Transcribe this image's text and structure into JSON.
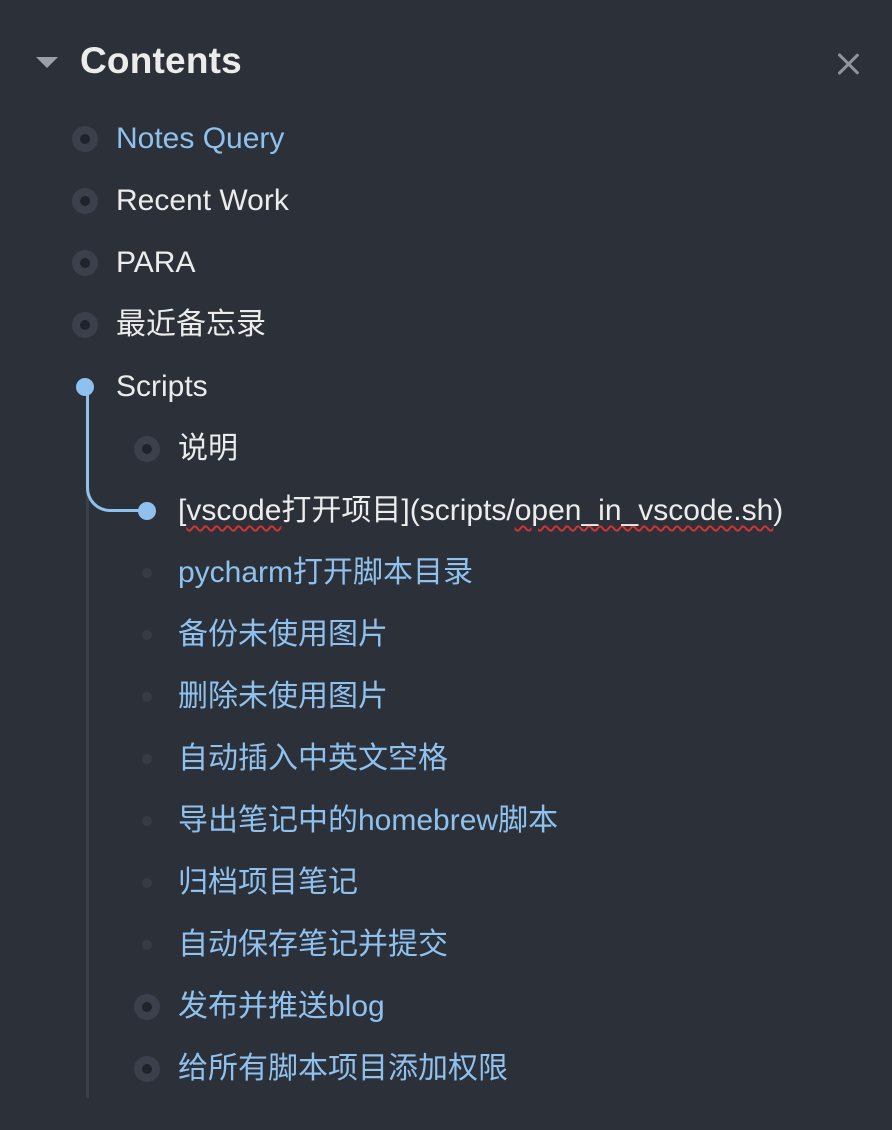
{
  "header": {
    "title": "Contents"
  },
  "accent_color": "#8fc1ee",
  "items": [
    {
      "label": "Notes Query",
      "link": true
    },
    {
      "label": "Recent Work",
      "link": false
    },
    {
      "label": "PARA",
      "link": false
    },
    {
      "label": "最近备忘录",
      "link": false
    },
    {
      "label": "Scripts",
      "link": false,
      "expanded": true
    },
    {
      "label": "说明",
      "link": false
    },
    {
      "label_prefix": "[",
      "label_squiggle_1": "vscode",
      "label_mid": "打开项目](scripts/",
      "label_squiggle_2": "open_in_vscode.sh",
      "label_suffix": ")",
      "link": false,
      "active": true
    },
    {
      "label": "pycharm打开脚本目录",
      "link": true
    },
    {
      "label": "备份未使用图片",
      "link": true
    },
    {
      "label": "删除未使用图片",
      "link": true
    },
    {
      "label": "自动插入中英文空格",
      "link": true
    },
    {
      "label": "导出笔记中的homebrew脚本",
      "link": true
    },
    {
      "label": "归档项目笔记",
      "link": true
    },
    {
      "label": "自动保存笔记并提交",
      "link": true
    },
    {
      "label": "发布并推送blog",
      "link": true
    },
    {
      "label": "给所有脚本项目添加权限",
      "link": true
    }
  ]
}
